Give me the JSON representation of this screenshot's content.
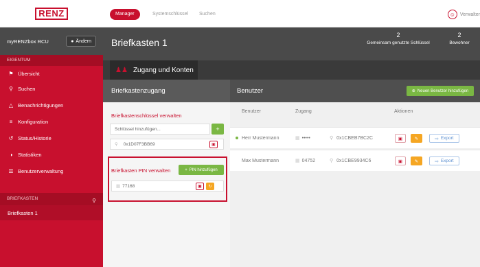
{
  "brand": {
    "logo": "RENZ"
  },
  "nav": {
    "tabs": [
      "Manager",
      "Systemschlüssel",
      "Suchen"
    ],
    "active": "Manager"
  },
  "user": {
    "label": "Verwalter"
  },
  "sidebar": {
    "box_name": "myRENZbox RCU",
    "change_label": "Ändern",
    "section_property": "EIGENTUM",
    "items": [
      {
        "icon": "flag-icon",
        "label": "Übersicht"
      },
      {
        "icon": "search-icon",
        "label": "Suchen"
      },
      {
        "icon": "bell-icon",
        "label": "Benachrichtigungen"
      },
      {
        "icon": "sliders-icon",
        "label": "Konfiguration"
      },
      {
        "icon": "history-icon",
        "label": "Status/Historie"
      },
      {
        "icon": "pie-chart-icon",
        "label": "Statistiken"
      },
      {
        "icon": "list-icon",
        "label": "Benutzerverwaltung"
      }
    ],
    "section_mailbox": "BRIEFKASTEN",
    "mailbox_items": [
      "Briefkasten 1"
    ]
  },
  "header": {
    "title": "Briefkasten 1",
    "stats": [
      {
        "value": "2",
        "label": "Gemeinsam genutzte Schlüssel"
      },
      {
        "value": "2",
        "label": "Bewohner"
      }
    ]
  },
  "subnav": {
    "tab_label": "Zugang und Konten"
  },
  "left_panel": {
    "title": "Briefkastenzugang",
    "keys_title": "Briefkastenschlüssel verwalten",
    "key_placeholder": "Schlüssel hinzufügen...",
    "add_symbol": "+",
    "keys": [
      "0x1D07F3BB69"
    ],
    "pin_title": "Briefkasten PIN verwalten",
    "pin_add_label": "PIN hinzufügen",
    "pins": [
      "77168"
    ]
  },
  "right_panel": {
    "title": "Benutzer",
    "add_user_label": "Neuen Benutzer hinzufügen",
    "columns": [
      "Benutzer",
      "Zugang",
      "Aktionen"
    ],
    "export_label": "Export",
    "rows": [
      {
        "name": "Herr Mustermann",
        "active": true,
        "pin": "•••••",
        "key": "0x1CBEB7BC2C"
      },
      {
        "name": "Max Mustermann",
        "active": false,
        "pin": "04752",
        "key": "0x1CBE9934C6"
      }
    ]
  },
  "colors": {
    "brand_red": "#c8102e",
    "green": "#7ab743",
    "orange": "#f5a623",
    "dark": "#4a4a4a"
  }
}
